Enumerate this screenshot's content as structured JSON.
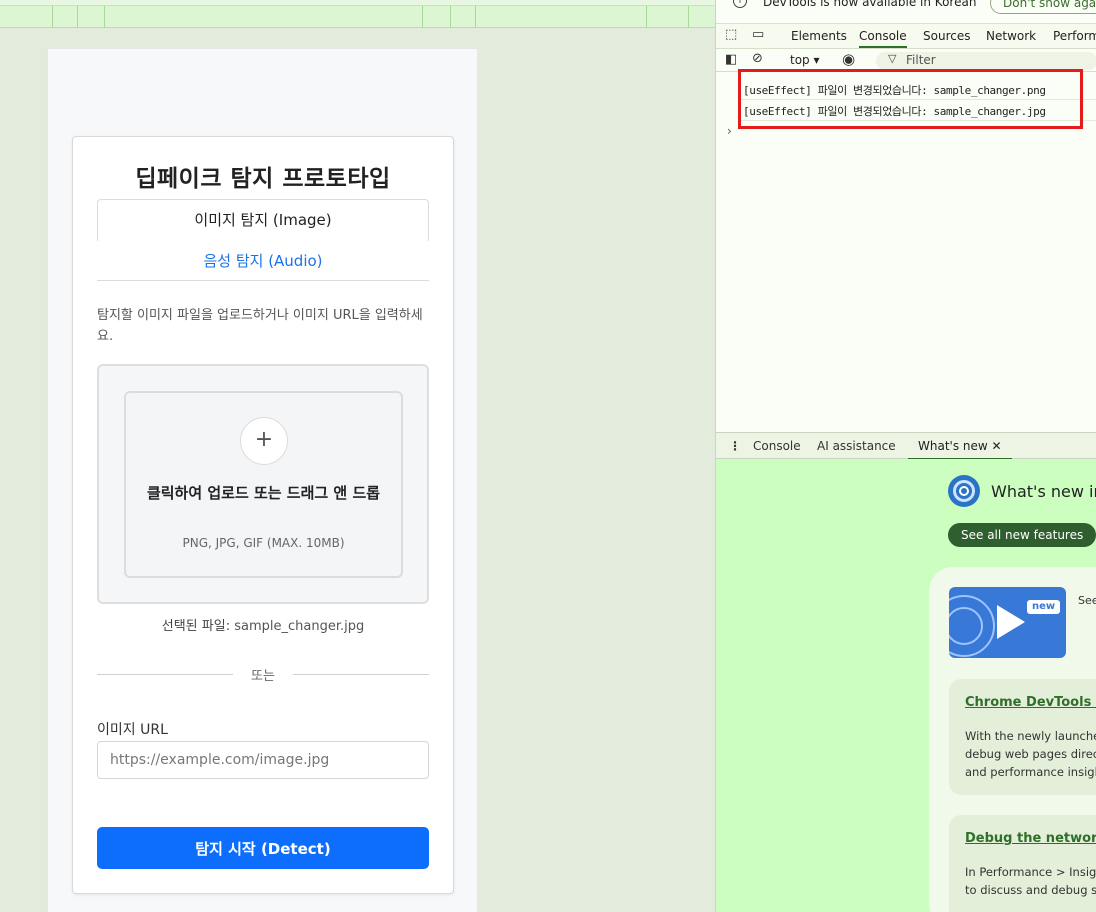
{
  "app": {
    "title": "딥페이크 탐지 프로토타입",
    "tabs": {
      "image": "이미지 탐지 (Image)",
      "audio": "음성 탐지 (Audio)"
    },
    "instructions": "탐지할 이미지 파일을 업로드하거나 이미지 URL을 입력하세요.",
    "dropzone": {
      "title": "클릭하여 업로드 또는 드래그 앤 드롭",
      "hint": "PNG, JPG, GIF (MAX. 10MB)",
      "plus": "+"
    },
    "selected_file": {
      "label": "선택된 파일:",
      "value": "sample_changer.jpg"
    },
    "divider_text": "또는",
    "url": {
      "label": "이미지 URL",
      "placeholder": "https://example.com/image.jpg",
      "value": ""
    },
    "detect_button": "탐지 시작 (Detect)",
    "colors": {
      "primary": "#0d6efd",
      "link": "#1a73e8"
    }
  },
  "devtools": {
    "infobar": {
      "text": "DevTools is now available in Korean",
      "dont_show": "Don't show again"
    },
    "tabs": [
      "Elements",
      "Console",
      "Sources",
      "Network",
      "Perform"
    ],
    "active_tab": "Console",
    "toolbar": {
      "context": "top ▾",
      "filter": "Filter"
    },
    "logs": [
      "[useEffect] 파일이 변경되었습니다: sample_changer.png",
      "[useEffect] 파일이 변경되었습니다: sample_changer.jpg"
    ],
    "highlight_color": "#e51a1a",
    "drawer_tabs": [
      "Console",
      "AI assistance",
      "What's new"
    ],
    "drawer_close": "✕",
    "whats_new": {
      "title": "What's new in",
      "see_all": "See all new features",
      "badge": "new",
      "promo_text": "See",
      "cards": [
        {
          "title": "Chrome DevTools (M",
          "lines": [
            "With the newly launched",
            "debug web pages direct",
            "and performance insight"
          ]
        },
        {
          "title": "Debug the network",
          "lines": [
            "In Performance > Insigh",
            "to discuss and debug sa"
          ]
        }
      ]
    },
    "icons": [
      "inspect-icon",
      "device-toggle-icon",
      "sidebar-icon",
      "clear-icon",
      "eye-icon",
      "filter-icon",
      "info-icon",
      "more-vert-icon",
      "chrome-logo"
    ]
  }
}
